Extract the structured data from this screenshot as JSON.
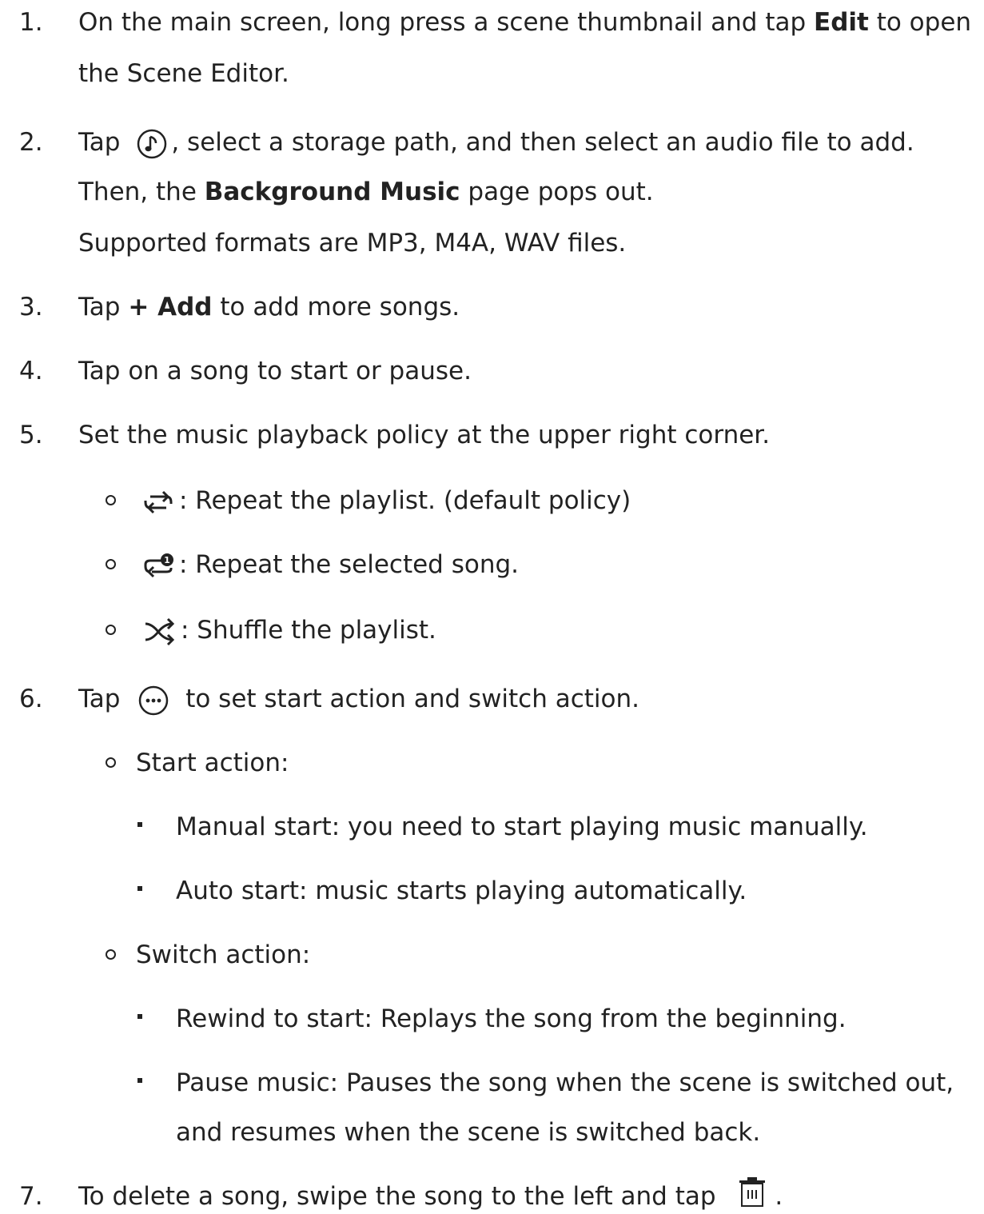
{
  "steps": [
    {
      "num": "1.",
      "pre": "On the main screen, long press a scene thumbnail and tap ",
      "bold": "Edit",
      "post": " to open",
      "line2": "the Scene Editor."
    },
    {
      "num": "2.",
      "pre": "Tap ",
      "post": ", select a storage path, and then select an audio file to add.",
      "line2_pre": "Then, the ",
      "line2_bold": "Background Music",
      "line2_post": " page pops out.",
      "line3": "Supported formats are MP3, M4A, WAV files.",
      "icon": "music-note-icon"
    },
    {
      "num": "3.",
      "pre": "Tap ",
      "bold": "+ Add",
      "post": " to add more songs."
    },
    {
      "num": "4.",
      "text": "Tap on a song to start or pause."
    },
    {
      "num": "5.",
      "text": "Set the music playback policy at the upper right corner.",
      "policies": [
        {
          "icon": "repeat-icon",
          "text": ": Repeat the playlist. (default policy)"
        },
        {
          "icon": "repeat-one-icon",
          "text": ": Repeat the selected song."
        },
        {
          "icon": "shuffle-icon",
          "text": ": Shuffle the playlist."
        }
      ]
    },
    {
      "num": "6.",
      "pre": "Tap ",
      "post": " to set start action and switch action.",
      "icon": "more-icon",
      "start_action": {
        "label": "Start action:",
        "items": [
          "Manual start: you need to start playing music manually.",
          "Auto start: music starts playing automatically."
        ]
      },
      "switch_action": {
        "label": "Switch action:",
        "items": [
          "Rewind to start: Replays the song from the beginning.",
          "Pause music: Pauses the song when the scene is switched out,"
        ],
        "continuation": "and resumes when the scene is switched back."
      }
    },
    {
      "num": "7.",
      "pre": "To delete a song, swipe the song to the left and tap ",
      "post": ".",
      "icon": "trash-icon"
    }
  ]
}
